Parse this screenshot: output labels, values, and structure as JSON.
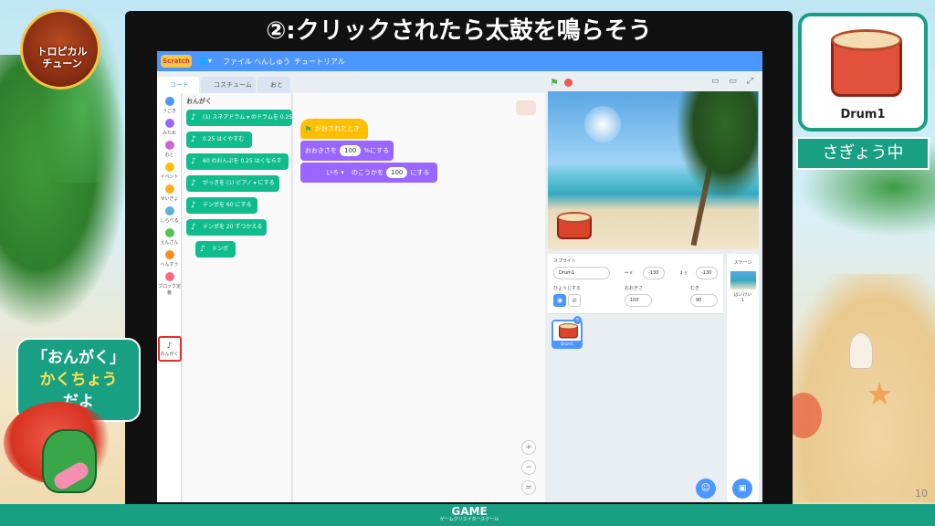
{
  "logo": {
    "line1": "トロピカル",
    "line2": "チューン"
  },
  "title": "②:クリックされたら太鼓を鳴らそう",
  "menubar": {
    "app_logo": "Scratch",
    "globe": "🌐▾",
    "file": "ファイル",
    "edit": "へんしゅう",
    "tutorial": "チュートリアル"
  },
  "tabs": {
    "code": "コード",
    "costume": "コスチューム",
    "sound": "おと"
  },
  "categories": [
    {
      "label": "うごき",
      "color": "#4c97ff"
    },
    {
      "label": "みため",
      "color": "#9966ff"
    },
    {
      "label": "おと",
      "color": "#cf63cf"
    },
    {
      "label": "イベント",
      "color": "#ffbf00"
    },
    {
      "label": "せいぎょ",
      "color": "#ffab19"
    },
    {
      "label": "しらべる",
      "color": "#5cb1d6"
    },
    {
      "label": "えんざん",
      "color": "#59c059"
    },
    {
      "label": "へんすう",
      "color": "#ff8c1a"
    },
    {
      "label": "ブロック定義",
      "color": "#ff6680"
    },
    {
      "label": "おんがく",
      "color": "#0fbd8c"
    }
  ],
  "palette": {
    "title": "おんがく",
    "blocks": [
      "(1) スネアドラム ▾ のドラムを 0.25",
      "0.25 はくやすむ",
      "60 のおんぷを 0.25 はくならす",
      "がっきを (1) ピアノ ▾ にする",
      "テンポを 60 にする",
      "テンポを 20 ずつかえる",
      "テンポ"
    ]
  },
  "script": {
    "hat": "がおされたとき",
    "size_block": {
      "pre": "おおきさを",
      "value": "100",
      "post": "%にする"
    },
    "effect_block": {
      "sel": "いろ ▾",
      "mid": "のこうかを",
      "value": "100",
      "post": "にする"
    }
  },
  "zoom": {
    "in": "+",
    "out": "−",
    "reset": "="
  },
  "stage_controls": {
    "flag": "⚑",
    "views": "▭ ▭ ⤢"
  },
  "sprite_panel": {
    "label": "スプライト",
    "name": "Drum1",
    "x_label": "x",
    "x": "-130",
    "y_label": "y",
    "y": "-130",
    "show_label": "ひょうじする",
    "size_label": "おおきさ",
    "size": "100",
    "direction_label": "むき",
    "direction": "90",
    "tile_name": "Drum1"
  },
  "stage_panel": {
    "label": "ステージ",
    "backdrops_label": "はいけい",
    "backdrops_count": "1"
  },
  "card": {
    "name": "Drum1"
  },
  "status": "さぎょう中",
  "bubble": {
    "line1": "「おんがく」",
    "line2": "かくちょう",
    "line3": "だよ"
  },
  "footer": {
    "logo": "GAME",
    "sub": "ゲームクリエイタースクール"
  },
  "page_number": "10",
  "colors": {
    "accent": "#19a083",
    "scratch_blue": "#4c97ff",
    "music_green": "#0fbd8c",
    "looks_purple": "#9966ff",
    "events_yellow": "#ffbf00"
  }
}
